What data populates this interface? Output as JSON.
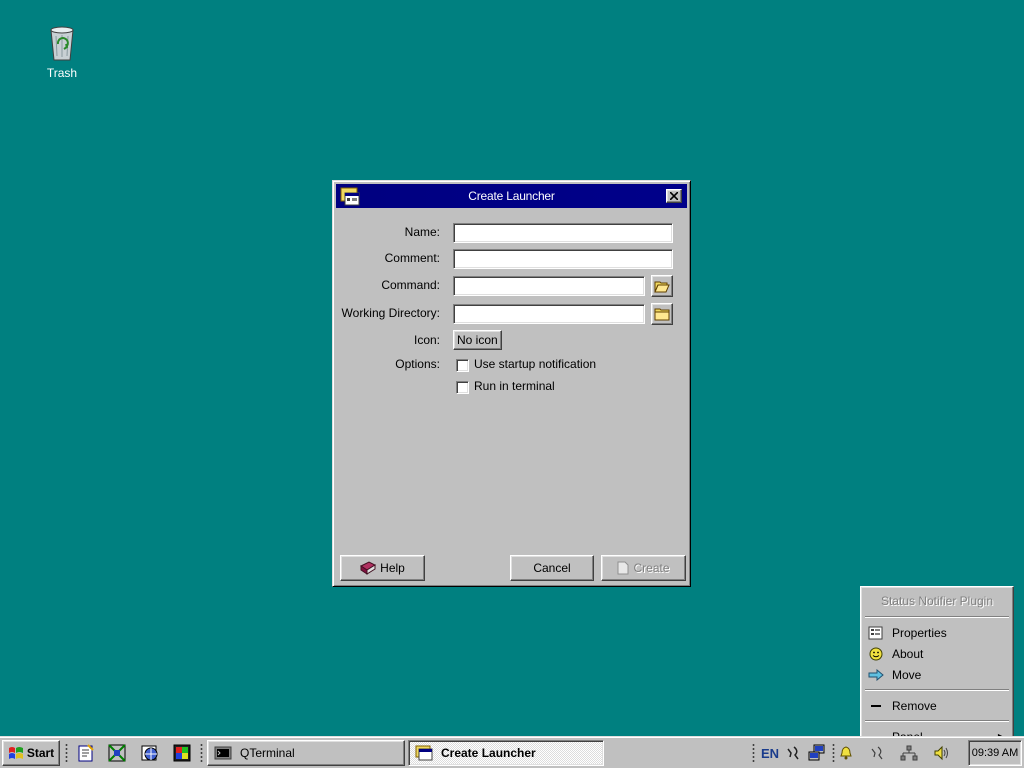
{
  "desktop": {
    "icons": [
      {
        "label": "Trash",
        "icon": "trash-icon"
      }
    ]
  },
  "dialog": {
    "title": "Create Launcher",
    "fields": {
      "name": {
        "label": "Name:",
        "value": ""
      },
      "comment": {
        "label": "Comment:",
        "value": ""
      },
      "command": {
        "label": "Command:",
        "value": ""
      },
      "working_directory": {
        "label": "Working Directory:",
        "value": ""
      }
    },
    "icon": {
      "label": "Icon:",
      "button_label": "No icon"
    },
    "options": {
      "label": "Options:",
      "startup_notification": {
        "label": "Use startup notification",
        "checked": false
      },
      "run_in_terminal": {
        "label": "Run in terminal",
        "checked": false
      }
    },
    "buttons": {
      "help": "Help",
      "cancel": "Cancel",
      "create": "Create"
    }
  },
  "context_menu": {
    "title": "Status Notifier Plugin",
    "items": [
      {
        "label": "Properties",
        "icon": "properties-icon"
      },
      {
        "label": "About",
        "icon": "smiley-icon"
      },
      {
        "label": "Move",
        "icon": "arrow-right-icon"
      },
      {
        "label": "Remove",
        "icon": "minus-icon"
      },
      {
        "label": "Panel",
        "icon": "",
        "submenu": true
      }
    ]
  },
  "taskbar": {
    "start_label": "Start",
    "tasks": [
      {
        "label": "QTerminal",
        "active": false
      },
      {
        "label": "Create Launcher",
        "active": true
      }
    ],
    "tray": {
      "language": "EN",
      "clock": "09:39 AM"
    }
  }
}
